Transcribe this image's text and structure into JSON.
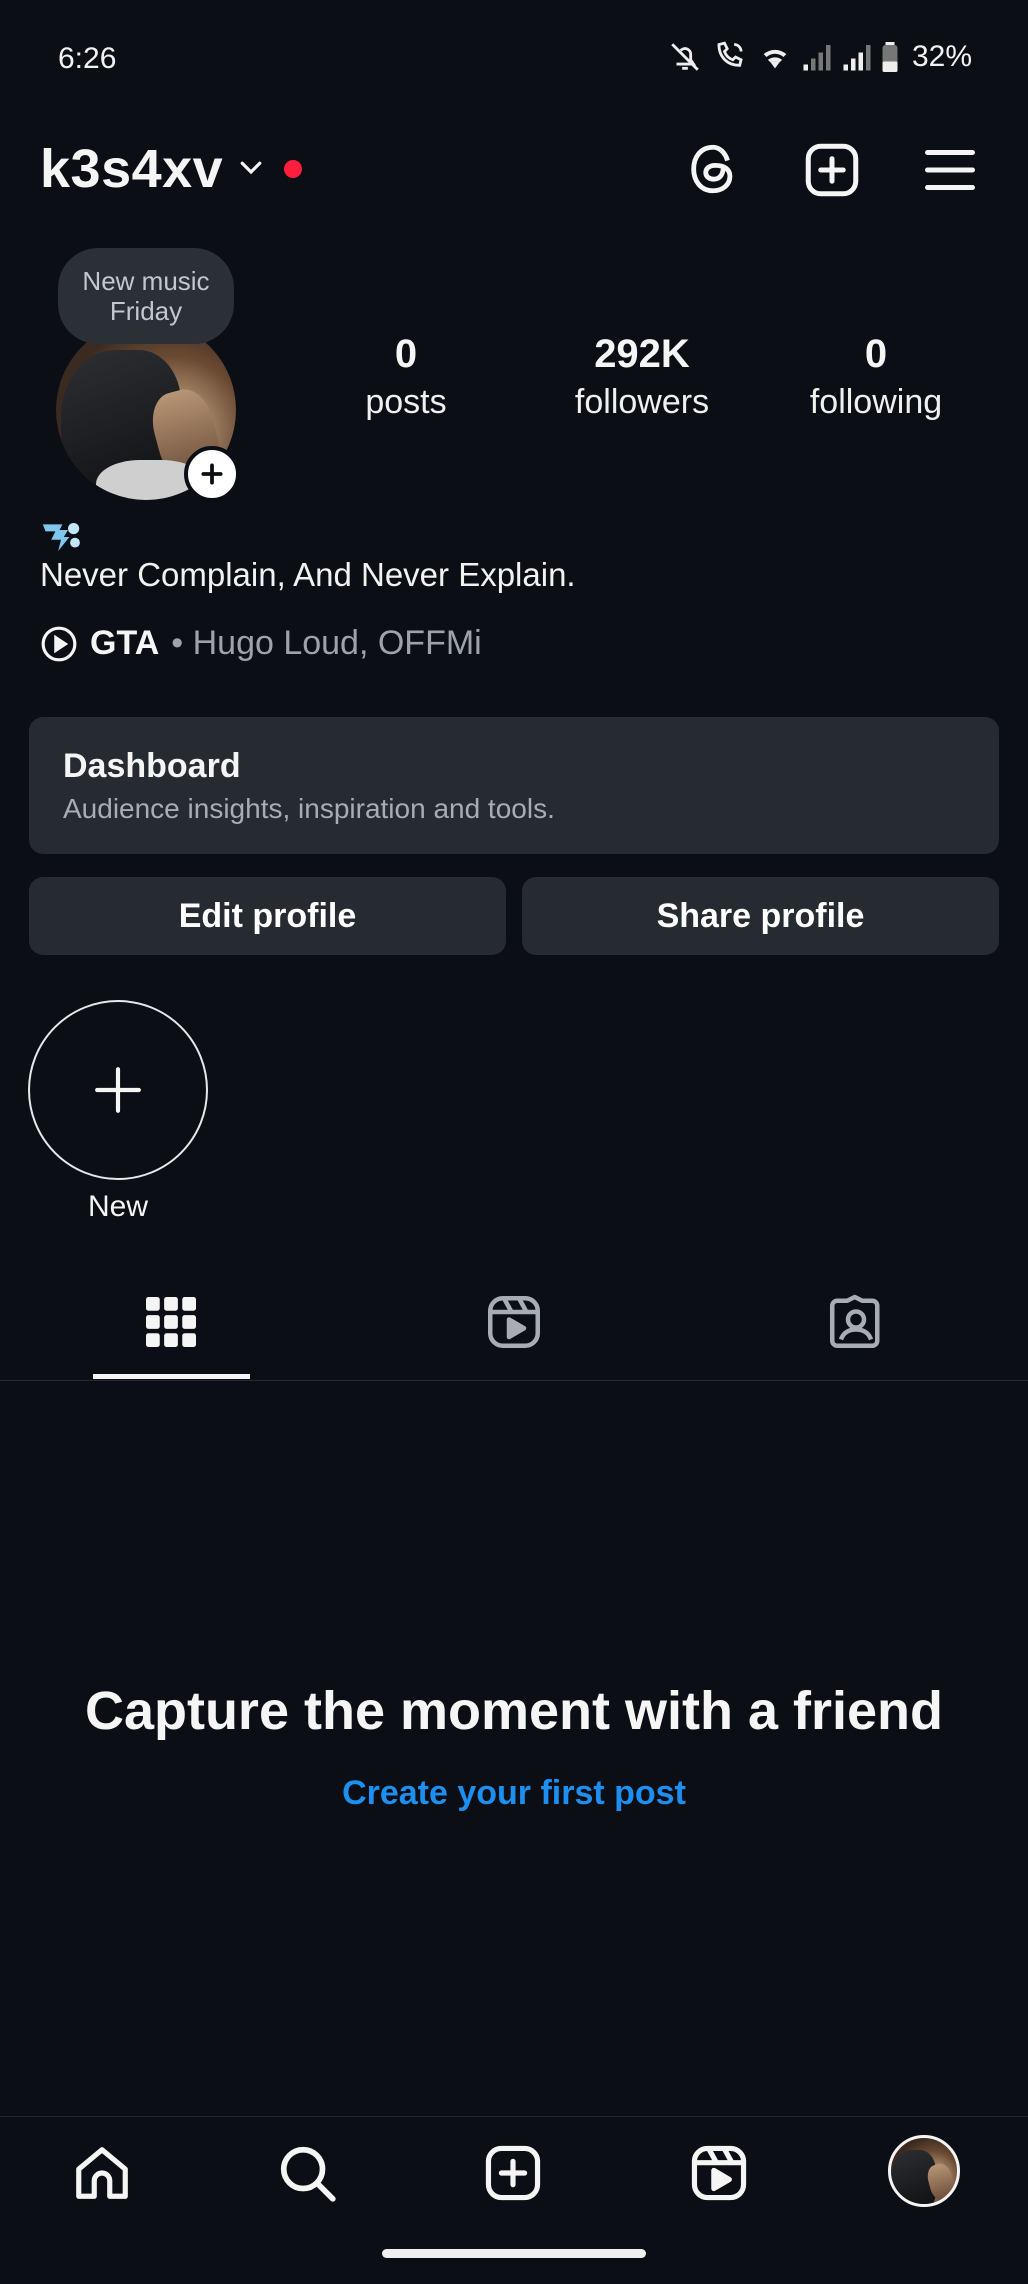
{
  "status_bar": {
    "time": "6:26",
    "battery": "32%",
    "icons": [
      "mute-icon",
      "wifi-call-icon",
      "wifi-icon",
      "signal-icon",
      "signal-icon",
      "battery-icon"
    ]
  },
  "header": {
    "username": "k3s4xv",
    "icons": [
      "threads-icon",
      "create-icon",
      "menu-icon"
    ]
  },
  "profile": {
    "note": {
      "line1": "New music",
      "line2": "Friday"
    },
    "stats": [
      {
        "value": "0",
        "label": "posts"
      },
      {
        "value": "292K",
        "label": "followers"
      },
      {
        "value": "0",
        "label": "following"
      }
    ],
    "bio": "Never Complain, And Never Explain.",
    "music": {
      "song": "GTA",
      "artist": "• Hugo Loud, OFFMi"
    }
  },
  "dashboard": {
    "title": "Dashboard",
    "subtitle": "Audience insights, inspiration and tools."
  },
  "buttons": {
    "edit_profile": "Edit profile",
    "share_profile": "Share profile"
  },
  "highlights": {
    "new_label": "New"
  },
  "tabs": [
    "grid-icon",
    "reels-icon",
    "tagged-icon"
  ],
  "empty_state": {
    "title": "Capture the moment with a friend",
    "link": "Create your first post"
  },
  "bottom_nav": [
    "home-icon",
    "search-icon",
    "create-icon",
    "reels-icon",
    "profile-avatar"
  ],
  "colors": {
    "background": "#0b0e14",
    "card": "#262a31",
    "link": "#1d8ff0",
    "accent_dot": "#ff1f3d"
  }
}
